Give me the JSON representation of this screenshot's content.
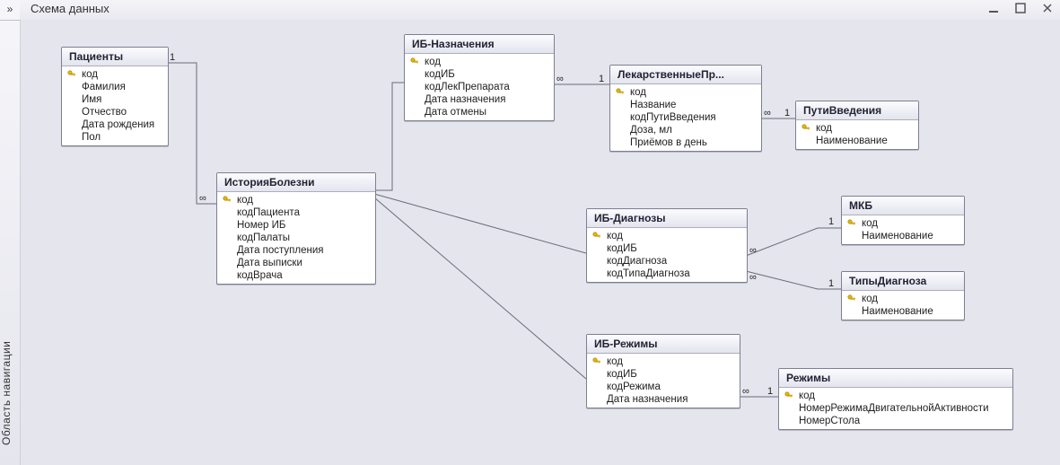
{
  "nav": {
    "expand_glyph": "»",
    "label": "Область навигации"
  },
  "header": {
    "title": "Схема данных"
  },
  "tables": {
    "patients": {
      "title": "Пациенты",
      "fields": [
        {
          "k": true,
          "n": "код"
        },
        {
          "n": "Фамилия"
        },
        {
          "n": "Имя"
        },
        {
          "n": "Отчество"
        },
        {
          "n": "Дата рождения"
        },
        {
          "n": "Пол"
        }
      ]
    },
    "history": {
      "title": "ИсторияБолезни",
      "fields": [
        {
          "k": true,
          "n": "код"
        },
        {
          "n": "кодПациента"
        },
        {
          "n": "Номер ИБ"
        },
        {
          "n": "кодПалаты"
        },
        {
          "n": "Дата поступления"
        },
        {
          "n": "Дата выписки"
        },
        {
          "n": "кодВрача"
        }
      ]
    },
    "ib_naz": {
      "title": "ИБ-Назначения",
      "fields": [
        {
          "k": true,
          "n": "код"
        },
        {
          "n": "кодИБ"
        },
        {
          "n": "кодЛекПрепарата"
        },
        {
          "n": "Дата назначения"
        },
        {
          "n": "Дата отмены"
        }
      ]
    },
    "lek": {
      "title": "ЛекарственныеПр...",
      "fields": [
        {
          "k": true,
          "n": "код"
        },
        {
          "n": "Название"
        },
        {
          "n": "кодПутиВведения"
        },
        {
          "n": "Доза, мл"
        },
        {
          "n": "Приёмов в день"
        }
      ]
    },
    "puti": {
      "title": "ПутиВведения",
      "fields": [
        {
          "k": true,
          "n": "код"
        },
        {
          "n": "Наименование"
        }
      ]
    },
    "ib_diag": {
      "title": "ИБ-Диагнозы",
      "fields": [
        {
          "k": true,
          "n": "код"
        },
        {
          "n": "кодИБ"
        },
        {
          "n": "кодДиагноза"
        },
        {
          "n": "кодТипаДиагноза"
        }
      ]
    },
    "mkb": {
      "title": "МКБ",
      "fields": [
        {
          "k": true,
          "n": "код"
        },
        {
          "n": "Наименование"
        }
      ]
    },
    "tipy": {
      "title": "ТипыДиагноза",
      "fields": [
        {
          "k": true,
          "n": "код"
        },
        {
          "n": "Наименование"
        }
      ]
    },
    "ib_rez": {
      "title": "ИБ-Режимы",
      "fields": [
        {
          "k": true,
          "n": "код"
        },
        {
          "n": "кодИБ"
        },
        {
          "n": "кодРежима"
        },
        {
          "n": "Дата назначения"
        }
      ]
    },
    "rezhimy": {
      "title": "Режимы",
      "fields": [
        {
          "k": true,
          "n": "код"
        },
        {
          "n": "НомерРежимаДвигательнойАктивности"
        },
        {
          "n": "НомерСтола"
        }
      ]
    }
  },
  "rel_labels": {
    "one": "1",
    "many": "∞"
  },
  "relationships": [
    {
      "from": "patients",
      "to": "history",
      "card": "1:∞"
    },
    {
      "from": "history",
      "to": "ib_naz",
      "card": "1:∞"
    },
    {
      "from": "history",
      "to": "ib_diag",
      "card": "1:∞"
    },
    {
      "from": "history",
      "to": "ib_rez",
      "card": "1:∞"
    },
    {
      "from": "ib_naz",
      "to": "lek",
      "card": "∞:1"
    },
    {
      "from": "lek",
      "to": "puti",
      "card": "∞:1"
    },
    {
      "from": "ib_diag",
      "to": "mkb",
      "card": "∞:1"
    },
    {
      "from": "ib_diag",
      "to": "tipy",
      "card": "∞:1"
    },
    {
      "from": "ib_rez",
      "to": "rezhimy",
      "card": "∞:1"
    }
  ]
}
